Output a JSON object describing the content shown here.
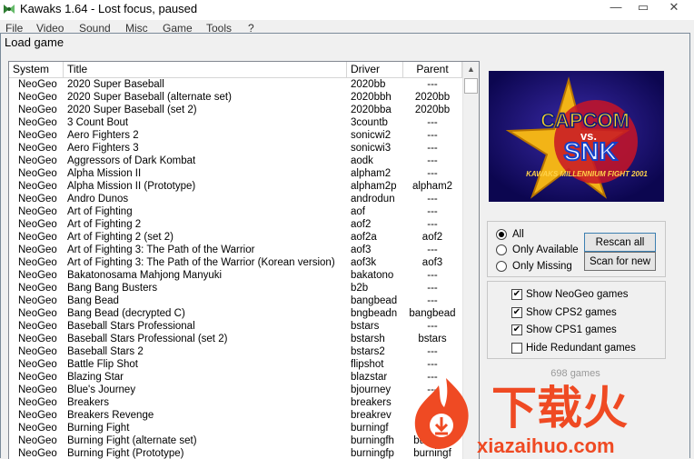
{
  "window": {
    "title": "Kawaks 1.64 - Lost focus, paused"
  },
  "menu": [
    "File",
    "Video",
    "Sound",
    "Misc",
    "Game",
    "Tools",
    "?"
  ],
  "dialog": {
    "title": "Load game"
  },
  "table": {
    "headers": {
      "system": "System",
      "title": "Title",
      "driver": "Driver",
      "parent": "Parent"
    },
    "rows": [
      {
        "system": "NeoGeo",
        "title": "2020 Super Baseball",
        "driver": "2020bb",
        "parent": "---"
      },
      {
        "system": "NeoGeo",
        "title": "2020 Super Baseball (alternate set)",
        "driver": "2020bbh",
        "parent": "2020bb"
      },
      {
        "system": "NeoGeo",
        "title": "2020 Super Baseball (set 2)",
        "driver": "2020bba",
        "parent": "2020bb"
      },
      {
        "system": "NeoGeo",
        "title": "3 Count Bout",
        "driver": "3countb",
        "parent": "---"
      },
      {
        "system": "NeoGeo",
        "title": "Aero Fighters 2",
        "driver": "sonicwi2",
        "parent": "---"
      },
      {
        "system": "NeoGeo",
        "title": "Aero Fighters 3",
        "driver": "sonicwi3",
        "parent": "---"
      },
      {
        "system": "NeoGeo",
        "title": "Aggressors of Dark Kombat",
        "driver": "aodk",
        "parent": "---"
      },
      {
        "system": "NeoGeo",
        "title": "Alpha Mission II",
        "driver": "alpham2",
        "parent": "---"
      },
      {
        "system": "NeoGeo",
        "title": "Alpha Mission II (Prototype)",
        "driver": "alpham2p",
        "parent": "alpham2"
      },
      {
        "system": "NeoGeo",
        "title": "Andro Dunos",
        "driver": "androdun",
        "parent": "---"
      },
      {
        "system": "NeoGeo",
        "title": "Art of Fighting",
        "driver": "aof",
        "parent": "---"
      },
      {
        "system": "NeoGeo",
        "title": "Art of Fighting 2",
        "driver": "aof2",
        "parent": "---"
      },
      {
        "system": "NeoGeo",
        "title": "Art of Fighting 2 (set 2)",
        "driver": "aof2a",
        "parent": "aof2"
      },
      {
        "system": "NeoGeo",
        "title": "Art of Fighting 3: The Path of the Warrior",
        "driver": "aof3",
        "parent": "---"
      },
      {
        "system": "NeoGeo",
        "title": "Art of Fighting 3: The Path of the Warrior (Korean version)",
        "driver": "aof3k",
        "parent": "aof3"
      },
      {
        "system": "NeoGeo",
        "title": "Bakatonosama Mahjong Manyuki",
        "driver": "bakatono",
        "parent": "---"
      },
      {
        "system": "NeoGeo",
        "title": "Bang Bang Busters",
        "driver": "b2b",
        "parent": "---"
      },
      {
        "system": "NeoGeo",
        "title": "Bang Bead",
        "driver": "bangbead",
        "parent": "---"
      },
      {
        "system": "NeoGeo",
        "title": "Bang Bead (decrypted C)",
        "driver": "bngbeadn",
        "parent": "bangbead"
      },
      {
        "system": "NeoGeo",
        "title": "Baseball Stars Professional",
        "driver": "bstars",
        "parent": "---"
      },
      {
        "system": "NeoGeo",
        "title": "Baseball Stars Professional (set 2)",
        "driver": "bstarsh",
        "parent": "bstars"
      },
      {
        "system": "NeoGeo",
        "title": "Baseball Stars 2",
        "driver": "bstars2",
        "parent": "---"
      },
      {
        "system": "NeoGeo",
        "title": "Battle Flip Shot",
        "driver": "flipshot",
        "parent": "---"
      },
      {
        "system": "NeoGeo",
        "title": "Blazing Star",
        "driver": "blazstar",
        "parent": "---"
      },
      {
        "system": "NeoGeo",
        "title": "Blue's Journey",
        "driver": "bjourney",
        "parent": "---"
      },
      {
        "system": "NeoGeo",
        "title": "Breakers",
        "driver": "breakers",
        "parent": "---"
      },
      {
        "system": "NeoGeo",
        "title": "Breakers Revenge",
        "driver": "breakrev",
        "parent": "---"
      },
      {
        "system": "NeoGeo",
        "title": "Burning Fight",
        "driver": "burningf",
        "parent": "---"
      },
      {
        "system": "NeoGeo",
        "title": "Burning Fight (alternate set)",
        "driver": "burningfh",
        "parent": "burningf"
      },
      {
        "system": "NeoGeo",
        "title": "Burning Fight (Prototype)",
        "driver": "burningfp",
        "parent": "burningf"
      }
    ]
  },
  "logo": {
    "line1": "CAPCOM",
    "line2": "vs.",
    "line3": "SNK",
    "tagline": "KAWAKS MILLENNIUM FIGHT 2001"
  },
  "filters": {
    "radios": [
      {
        "label": "All",
        "selected": true
      },
      {
        "label": "Only Available",
        "selected": false
      },
      {
        "label": "Only Missing",
        "selected": false
      }
    ],
    "rescan_label": "Rescan all",
    "scan_label": "Scan for new"
  },
  "options": [
    {
      "label": "Show NeoGeo games",
      "checked": true
    },
    {
      "label": "Show CPS2 games",
      "checked": true
    },
    {
      "label": "Show CPS1 games",
      "checked": true
    },
    {
      "label": "Hide Redundant games",
      "checked": false
    }
  ],
  "status": {
    "count": "698 games"
  },
  "watermark": {
    "cn": "下载火",
    "url": "xiazaihuo.com"
  }
}
